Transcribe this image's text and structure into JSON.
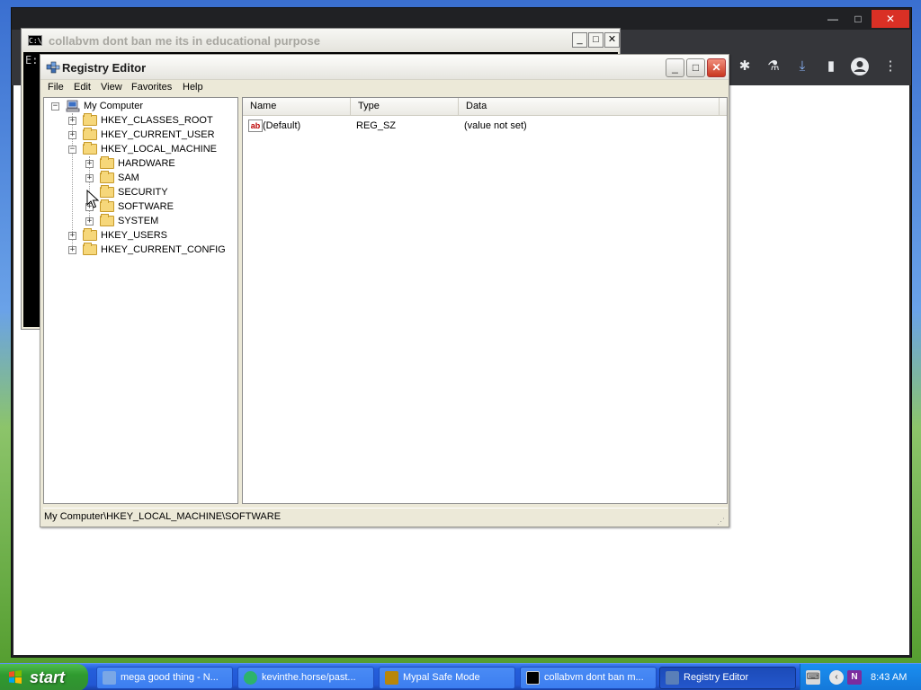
{
  "console": {
    "title": "collabvm dont ban me its in educational purpose",
    "prompt": "E:",
    "min": "_",
    "max": "□",
    "close": "✕"
  },
  "chrome": {
    "min": "—",
    "max": "□",
    "close": "✕"
  },
  "regedit": {
    "title": "Registry Editor",
    "menu": [
      "File",
      "Edit",
      "View",
      "Favorites",
      "Help"
    ],
    "tree": {
      "root": "My Computer",
      "hives": [
        {
          "label": "HKEY_CLASSES_ROOT",
          "expanded": false
        },
        {
          "label": "HKEY_CURRENT_USER",
          "expanded": false
        },
        {
          "label": "HKEY_LOCAL_MACHINE",
          "expanded": true
        },
        {
          "label": "HKEY_USERS",
          "expanded": false
        },
        {
          "label": "HKEY_CURRENT_CONFIG",
          "expanded": false
        }
      ],
      "hklm_children": [
        {
          "label": "HARDWARE",
          "has_children": true
        },
        {
          "label": "SAM",
          "has_children": true
        },
        {
          "label": "SECURITY",
          "has_children": false
        },
        {
          "label": "SOFTWARE",
          "has_children": true
        },
        {
          "label": "SYSTEM",
          "has_children": true
        }
      ]
    },
    "columns": [
      "Name",
      "Type",
      "Data"
    ],
    "values": [
      {
        "icon": "ab",
        "name": "(Default)",
        "type": "REG_SZ",
        "data": "(value not set)"
      }
    ],
    "status": "My Computer\\HKEY_LOCAL_MACHINE\\SOFTWARE"
  },
  "taskbar": {
    "start": "start",
    "tasks": [
      {
        "label": "mega good thing - N...",
        "icon": "notepad-icon",
        "color": "#7aa7e6",
        "active": false
      },
      {
        "label": "kevinthe.horse/past...",
        "icon": "browser-icon",
        "color": "#2db36b",
        "active": false
      },
      {
        "label": "Mypal Safe Mode",
        "icon": "mypal-icon",
        "color": "#b8860b",
        "active": false
      },
      {
        "label": "collabvm dont ban m...",
        "icon": "console-icon",
        "color": "#000000",
        "active": false
      },
      {
        "label": "Registry Editor",
        "icon": "regedit-icon",
        "color": "#5a7fb8",
        "active": true
      }
    ],
    "tray_icons": [
      "keyboard-icon",
      "back-icon",
      "onenote-icon"
    ],
    "onenote_letter": "N",
    "clock": "8:43 AM"
  },
  "colors": {
    "xp_blue": "#245edb",
    "start_green": "#2f9a2f",
    "close_red": "#c9371f"
  }
}
